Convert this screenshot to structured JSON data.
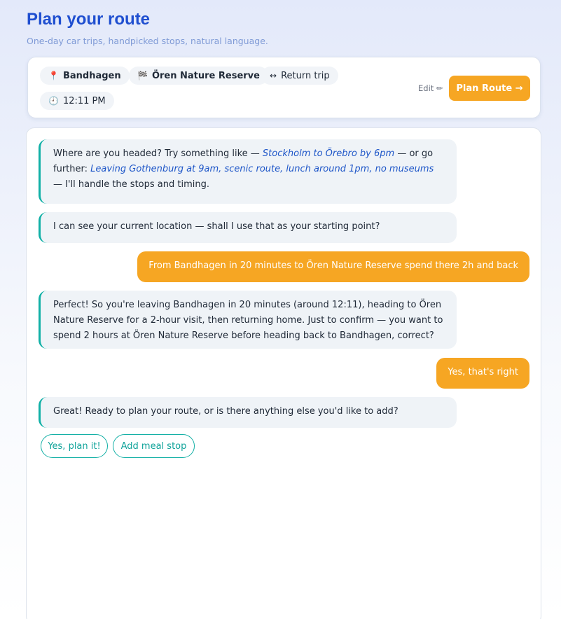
{
  "header": {
    "title": "Plan your route",
    "subtitle": "One-day car trips, handpicked stops, natural language."
  },
  "trip": {
    "origin": "Bandhagen",
    "origin_icon": "pin-icon",
    "destination": "Ören Nature Reserve",
    "destination_icon": "checkered-flag-icon",
    "return_label": "Return trip",
    "return_icon": "round-trip-arrows-icon",
    "time": "12:11 PM",
    "time_icon": "clock-icon",
    "edit_label": "Edit ✏",
    "plan_button": "Plan Route →"
  },
  "chat": {
    "m1": {
      "text_a": "Where are you headed? Try something like — ",
      "example_1": "Stockholm to Örebro by 6pm",
      "text_b": " — or go further: ",
      "example_2": "Leaving Gothenburg at 9am, scenic route, lunch around 1pm, no museums",
      "text_c": " — I'll handle the stops and timing."
    },
    "m2": "I can see your current location — shall I use that as your starting point?",
    "m3": "From Bandhagen in 20 minutes to Ören Nature Reserve spend there 2h and back",
    "m4": "Perfect! So you're leaving Bandhagen in 20 minutes (around 12:11), heading to Ören Nature Reserve for a 2-hour visit, then returning home. Just to confirm — you want to spend 2 hours at Ören Nature Reserve before heading back to Bandhagen, correct?",
    "m5": "Yes, that's right",
    "m6": "Great! Ready to plan your route, or is there anything else you'd like to add?",
    "quick_replies": [
      "Yes, plan it!",
      "Add meal stop"
    ]
  },
  "colors": {
    "accent": "#f6a623",
    "title_blue": "#1f4fd0",
    "teal": "#10b0a6",
    "example_blue": "#1e56c8"
  }
}
